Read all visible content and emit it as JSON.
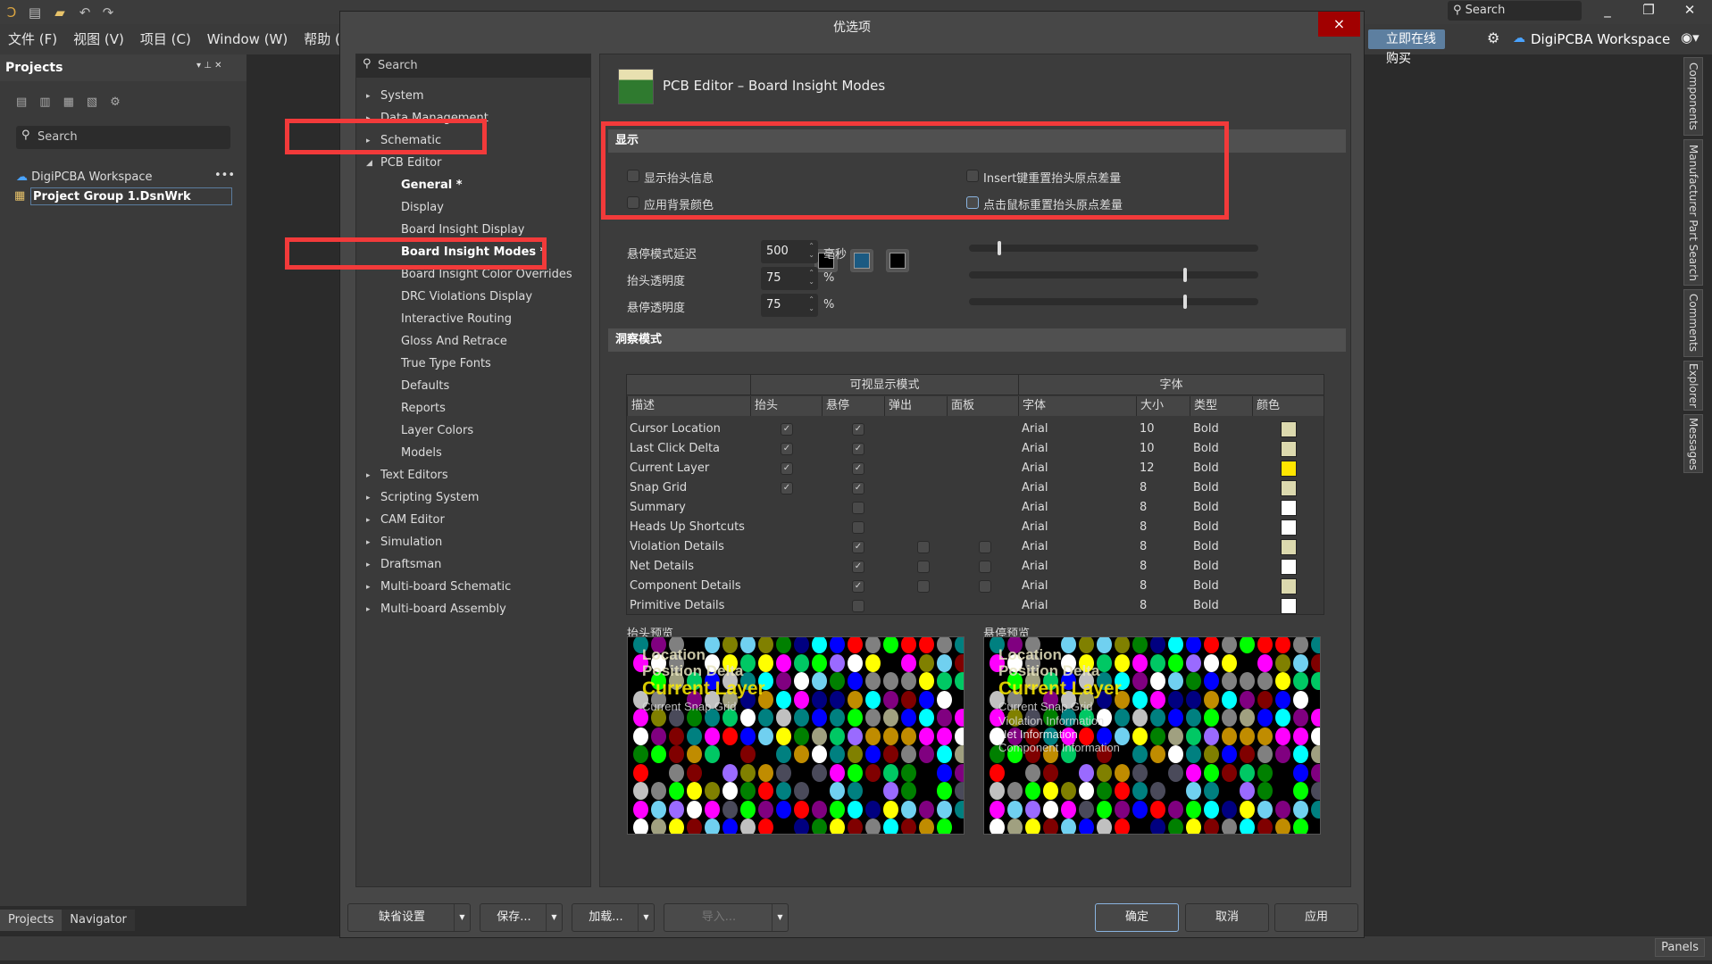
{
  "app": {
    "menu": [
      "文件 (F)",
      "视图 (V)",
      "项目 (C)",
      "Window (W)",
      "帮助 (H)"
    ],
    "search": "Search",
    "buy": "立即在线购买",
    "workspace": "DigiPCBA Workspace",
    "panels": "Panels",
    "right_tabs": [
      "Components",
      "Manufacturer Part Search",
      "Comments",
      "Explorer",
      "Messages"
    ]
  },
  "projects": {
    "title": "Projects",
    "search": "Search",
    "workspace": "DigiPCBA Workspace",
    "group": "Project Group 1.DsnWrk",
    "tabs": [
      "Projects",
      "Navigator"
    ]
  },
  "dialog": {
    "title": "优选项",
    "close": "×",
    "search": "Search",
    "tree": [
      {
        "label": "System",
        "level": 0,
        "arrow": "▸"
      },
      {
        "label": "Data Management",
        "level": 0,
        "arrow": "▸"
      },
      {
        "label": "Schematic",
        "level": 0,
        "arrow": "▸"
      },
      {
        "label": "PCB Editor",
        "level": 0,
        "arrow": "◢"
      },
      {
        "label": "General *",
        "level": 1,
        "bold": true
      },
      {
        "label": "Display",
        "level": 1
      },
      {
        "label": "Board Insight Display",
        "level": 1
      },
      {
        "label": "Board Insight Modes *",
        "level": 1,
        "bold": true,
        "selected": true
      },
      {
        "label": "Board Insight Color Overrides",
        "level": 1
      },
      {
        "label": "DRC Violations Display",
        "level": 1
      },
      {
        "label": "Interactive Routing",
        "level": 1
      },
      {
        "label": "Gloss And Retrace",
        "level": 1
      },
      {
        "label": "True Type Fonts",
        "level": 1
      },
      {
        "label": "Defaults",
        "level": 1
      },
      {
        "label": "Reports",
        "level": 1
      },
      {
        "label": "Layer Colors",
        "level": 1
      },
      {
        "label": "Models",
        "level": 1
      },
      {
        "label": "Text Editors",
        "level": 0,
        "arrow": "▸"
      },
      {
        "label": "Scripting System",
        "level": 0,
        "arrow": "▸"
      },
      {
        "label": "CAM Editor",
        "level": 0,
        "arrow": "▸"
      },
      {
        "label": "Simulation",
        "level": 0,
        "arrow": "▸"
      },
      {
        "label": "Draftsman",
        "level": 0,
        "arrow": "▸"
      },
      {
        "label": "Multi-board Schematic",
        "level": 0,
        "arrow": "▸"
      },
      {
        "label": "Multi-board Assembly",
        "level": 0,
        "arrow": "▸"
      }
    ],
    "page_title": "PCB Editor – Board Insight Modes",
    "display": {
      "header": "显示",
      "show_heads_up": {
        "label": "显示抬头信息",
        "checked": false
      },
      "apply_bg": {
        "label": "应用背景颜色",
        "checked": false
      },
      "insert_reset": {
        "label": "Insert键重置抬头原点差量",
        "checked": false
      },
      "click_reset": {
        "label": "点击鼠标重置抬头原点差量",
        "checked": false
      },
      "bg_colors": [
        "#000000",
        "#1b5a82",
        "#000000"
      ]
    },
    "settings": [
      {
        "label": "悬停模式延迟",
        "value": "500",
        "unit": "毫秒",
        "slider": 0.1
      },
      {
        "label": "抬头透明度",
        "value": "75",
        "unit": "%",
        "slider": 0.75
      },
      {
        "label": "悬停透明度",
        "value": "75",
        "unit": "%",
        "slider": 0.75
      }
    ],
    "insight": {
      "header": "洞察模式",
      "group1": "可视显示模式",
      "group2": "字体",
      "columns": [
        "描述",
        "抬头",
        "悬停",
        "弹出",
        "面板",
        "字体",
        "大小",
        "类型",
        "颜色"
      ],
      "rows": [
        {
          "desc": "Cursor Location",
          "head": true,
          "hover": true,
          "popup": null,
          "panel": null,
          "font": "Arial",
          "size": "10",
          "type": "Bold",
          "color": "#dcd9ae"
        },
        {
          "desc": "Last Click Delta",
          "head": true,
          "hover": true,
          "popup": null,
          "panel": null,
          "font": "Arial",
          "size": "10",
          "type": "Bold",
          "color": "#dcd9ae"
        },
        {
          "desc": "Current Layer",
          "head": true,
          "hover": true,
          "popup": null,
          "panel": null,
          "font": "Arial",
          "size": "12",
          "type": "Bold",
          "color": "#ffe600"
        },
        {
          "desc": "Snap Grid",
          "head": true,
          "hover": true,
          "popup": null,
          "panel": null,
          "font": "Arial",
          "size": "8",
          "type": "Bold",
          "color": "#dcd9ae"
        },
        {
          "desc": "Summary",
          "head": null,
          "hover": false,
          "popup": null,
          "panel": null,
          "font": "Arial",
          "size": "8",
          "type": "Bold",
          "color": "#ffffff"
        },
        {
          "desc": "Heads Up Shortcuts",
          "head": null,
          "hover": false,
          "popup": null,
          "panel": null,
          "font": "Arial",
          "size": "8",
          "type": "Bold",
          "color": "#ffffff"
        },
        {
          "desc": "Violation Details",
          "head": null,
          "hover": true,
          "popup": false,
          "panel": false,
          "font": "Arial",
          "size": "8",
          "type": "Bold",
          "color": "#dcd9ae"
        },
        {
          "desc": "Net Details",
          "head": null,
          "hover": true,
          "popup": false,
          "panel": false,
          "font": "Arial",
          "size": "8",
          "type": "Bold",
          "color": "#ffffff"
        },
        {
          "desc": "Component Details",
          "head": null,
          "hover": true,
          "popup": false,
          "panel": false,
          "font": "Arial",
          "size": "8",
          "type": "Bold",
          "color": "#dcd9ae"
        },
        {
          "desc": "Primitive Details",
          "head": null,
          "hover": false,
          "popup": null,
          "panel": null,
          "font": "Arial",
          "size": "8",
          "type": "Bold",
          "color": "#ffffff"
        }
      ]
    },
    "preview": {
      "heads_up_label": "抬头预览",
      "hover_label": "悬停预览",
      "heads_up_lines": [
        "Location",
        "Position Delta",
        "Current Layer",
        "Current Snap Grid"
      ],
      "hover_lines": [
        "Location",
        "Position Delta",
        "Current Layer",
        "Current Snap Grid",
        "Violation Information",
        "Net Information",
        "Component Information"
      ]
    },
    "buttons": {
      "defaults": "缺省设置",
      "save": "保存...",
      "load": "加载...",
      "import": "导入...",
      "ok": "确定",
      "cancel": "取消",
      "apply": "应用"
    }
  }
}
